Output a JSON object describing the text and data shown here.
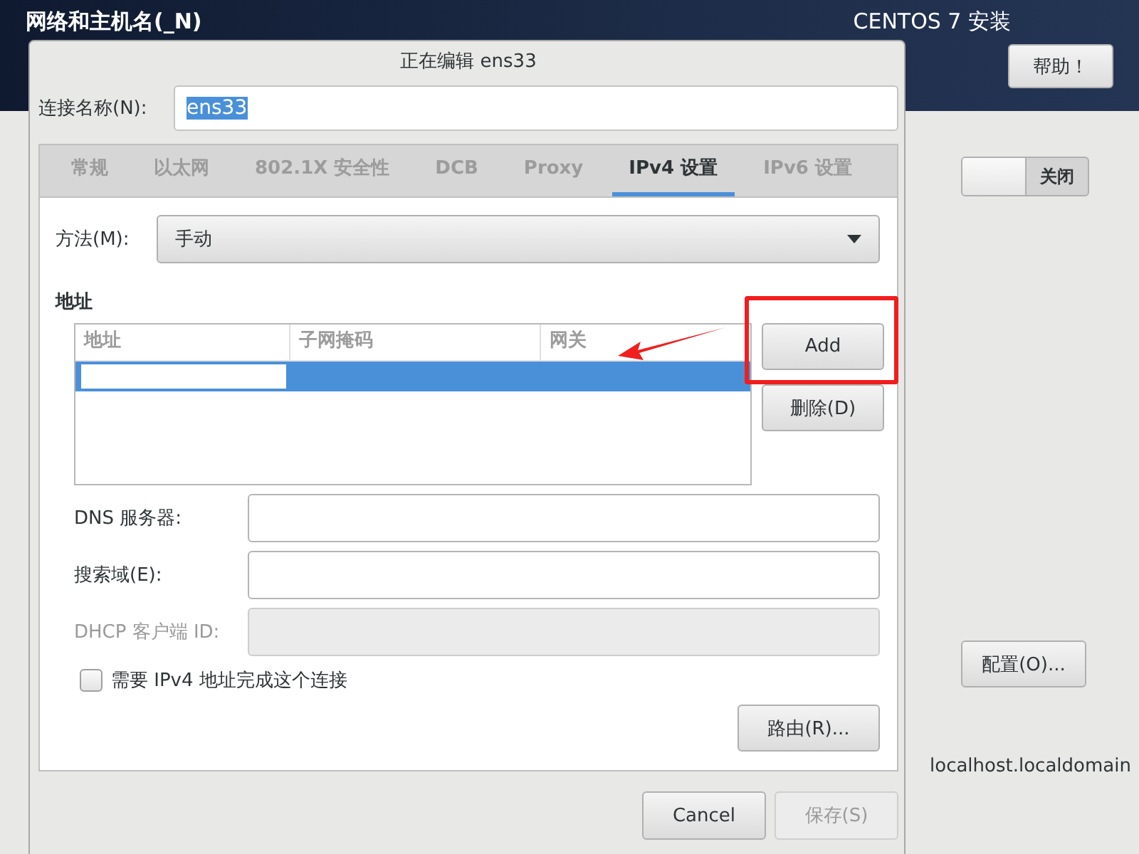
{
  "screen": {
    "title": "网络和主机名(_N)",
    "product": "CENTOS 7 安装",
    "help_button": "帮助！"
  },
  "device": {
    "toggle": {
      "label": "关闭",
      "on": false
    },
    "configure_button": "配置(O)...",
    "hostname": "localhost.localdomain"
  },
  "dialog": {
    "title": "正在编辑 ens33",
    "connection_name": {
      "label": "连接名称(N):",
      "value": "ens33"
    },
    "tabs": [
      {
        "label": "常规",
        "selected": false
      },
      {
        "label": "以太网",
        "selected": false
      },
      {
        "label": "802.1X 安全性",
        "selected": false
      },
      {
        "label": "DCB",
        "selected": false
      },
      {
        "label": "Proxy",
        "selected": false
      },
      {
        "label": "IPv4 设置",
        "selected": true
      },
      {
        "label": "IPv6 设置",
        "selected": false
      }
    ],
    "method": {
      "label": "方法(M):",
      "value": "手动"
    },
    "addresses": {
      "heading": "地址",
      "columns": [
        "地址",
        "子网掩码",
        "网关"
      ],
      "rows": [
        {
          "selected": true,
          "editing": true
        }
      ],
      "buttons": [
        "Add",
        "删除(D)"
      ]
    },
    "fields": [
      {
        "label": "DNS 服务器:",
        "disabled": false
      },
      {
        "label": "搜索域(E):",
        "disabled": false
      },
      {
        "label": "DHCP 客户端 ID:",
        "disabled": true
      }
    ],
    "require_ipv4": {
      "label": "需要 IPv4 地址完成这个连接",
      "checked": false
    },
    "routes_button": "路由(R)...",
    "buttons": [
      {
        "label": "Cancel",
        "disabled": false
      },
      {
        "label": "保存(S)",
        "disabled": true
      }
    ]
  }
}
